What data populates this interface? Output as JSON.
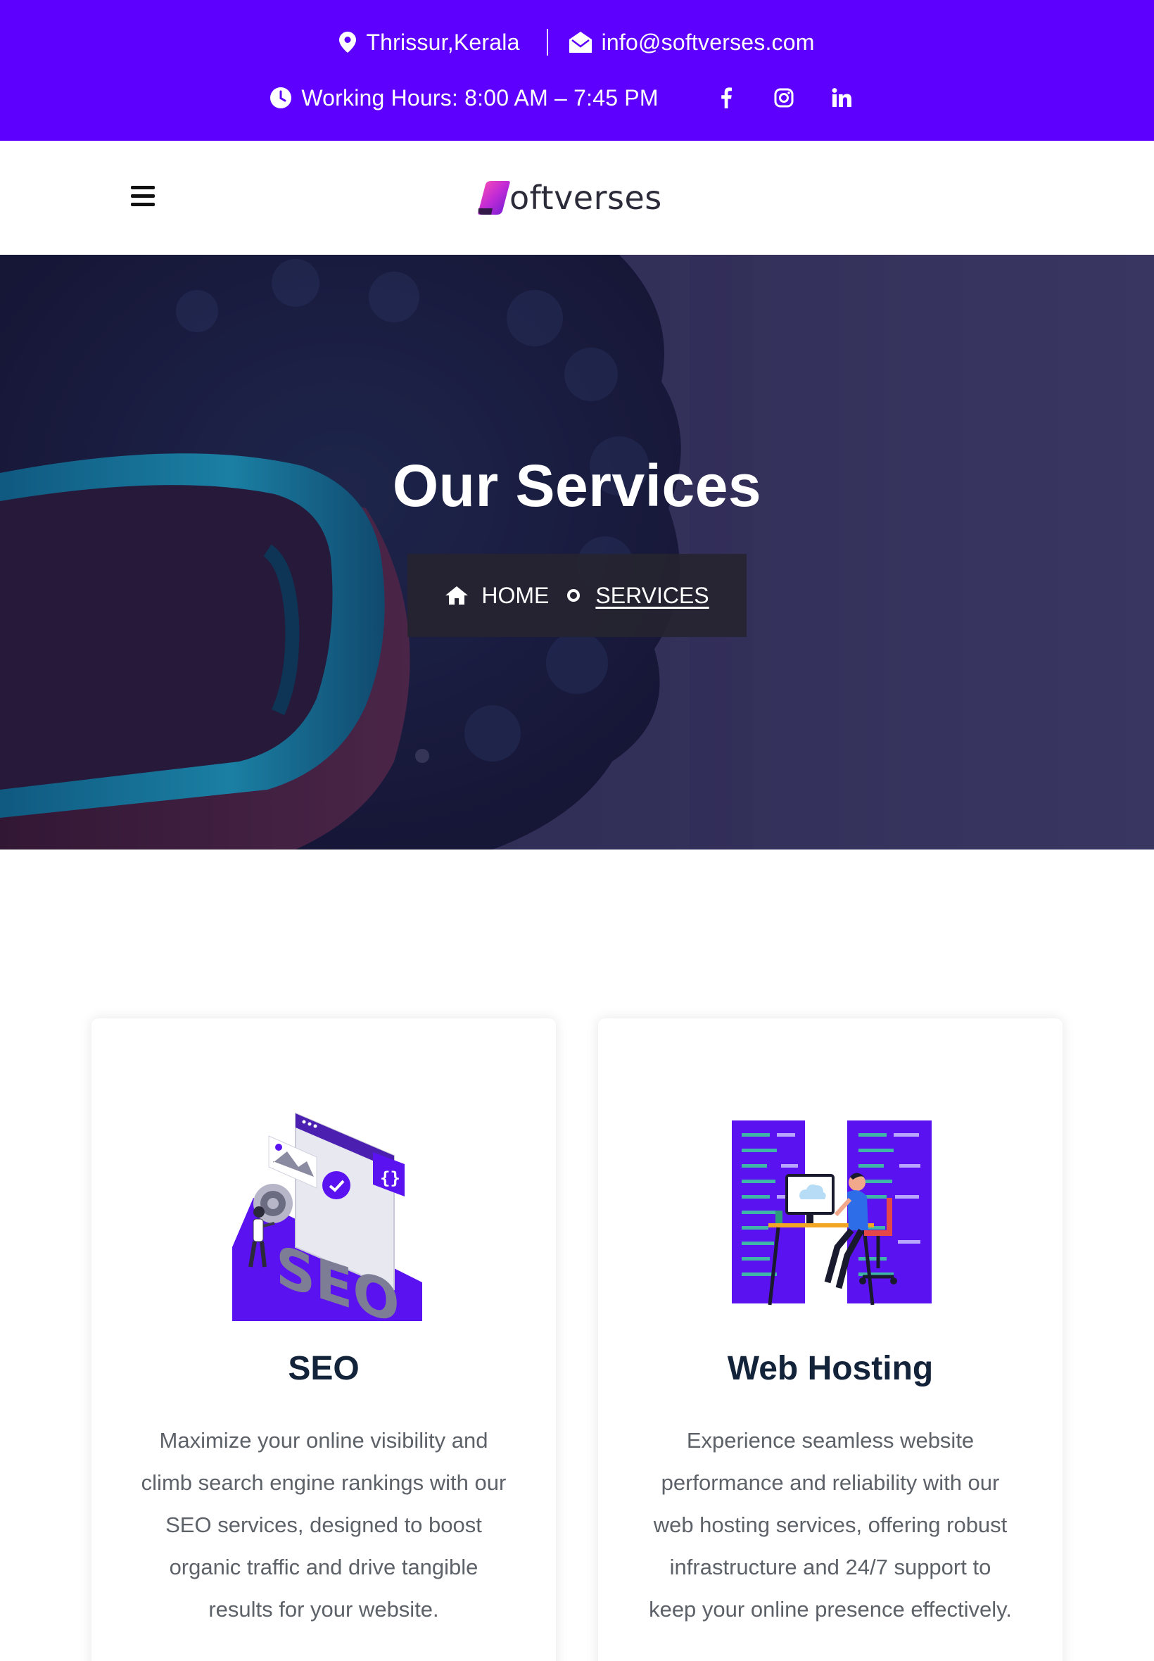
{
  "topbar": {
    "location": "Thrissur,Kerala",
    "email": "info@softverses.com",
    "hours": "Working Hours: 8:00 AM – 7:45 PM",
    "social": [
      "facebook-icon",
      "instagram-icon",
      "linkedin-icon"
    ],
    "background": "#5e00fd"
  },
  "header": {
    "logo_text": "oftverses"
  },
  "hero": {
    "title": "Our Services",
    "breadcrumb": {
      "home": "HOME",
      "current": "SERVICES"
    }
  },
  "services": [
    {
      "title": "SEO",
      "description": "Maximize your online visibility and climb search engine rankings with our SEO services, designed to boost organic traffic and drive tangible results for your website.",
      "illustration_text": "SEO"
    },
    {
      "title": "Web Hosting",
      "description": "Experience seamless website performance and reliability with our web hosting services, offering robust infrastructure and 24/7 support to keep your online presence effectively."
    }
  ],
  "colors": {
    "accent": "#5e00fd",
    "heading": "#13233a",
    "body_text": "#5d6168"
  }
}
